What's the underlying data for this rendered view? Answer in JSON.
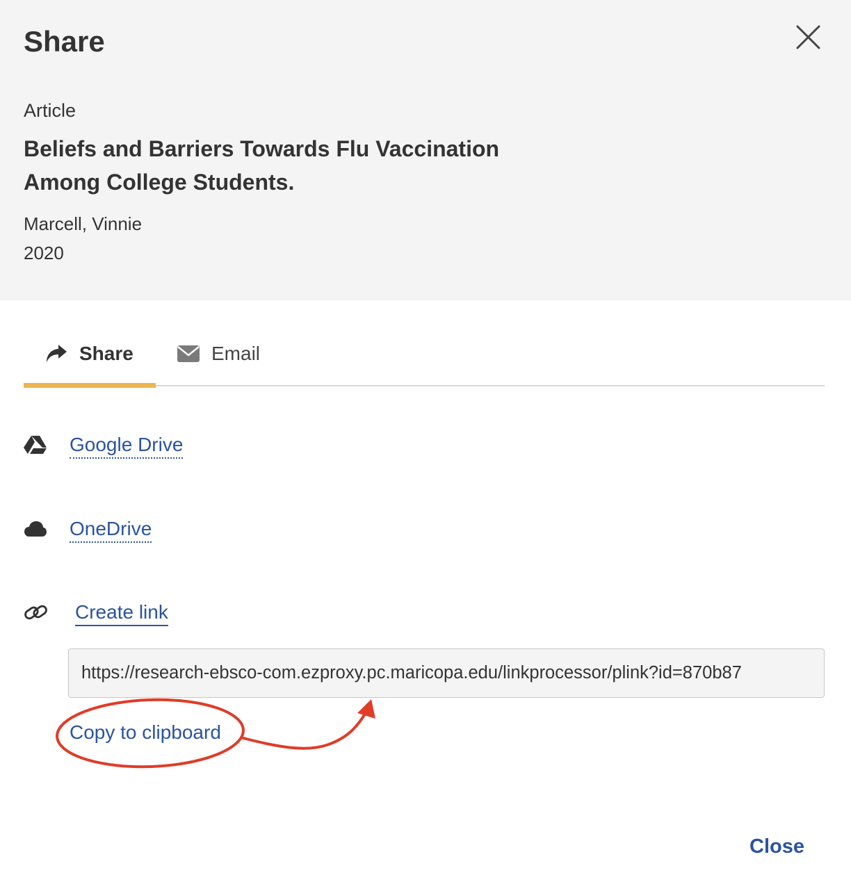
{
  "dialog": {
    "title": "Share",
    "close_icon": "close-icon"
  },
  "item": {
    "type": "Article",
    "title": "Beliefs and Barriers Towards Flu Vaccination Among College Students.",
    "author": "Marcell, Vinnie",
    "year": "2020"
  },
  "tabs": [
    {
      "label": "Share",
      "icon": "share-arrow-icon",
      "active": true
    },
    {
      "label": "Email",
      "icon": "envelope-icon",
      "active": false
    }
  ],
  "share_options": [
    {
      "label": "Google Drive",
      "icon": "google-drive-icon"
    },
    {
      "label": "OneDrive",
      "icon": "cloud-icon"
    },
    {
      "label": "Create link",
      "icon": "chain-link-icon"
    }
  ],
  "permalink": {
    "value": "https://research-ebsco-com.ezproxy.pc.maricopa.edu/linkprocessor/plink?id=870b87"
  },
  "copy_label": "Copy to clipboard",
  "annotation_color": "#e03c27",
  "accent_color": "#eeb54f",
  "link_color": "#2b53a0",
  "footer": {
    "close_label": "Close"
  }
}
